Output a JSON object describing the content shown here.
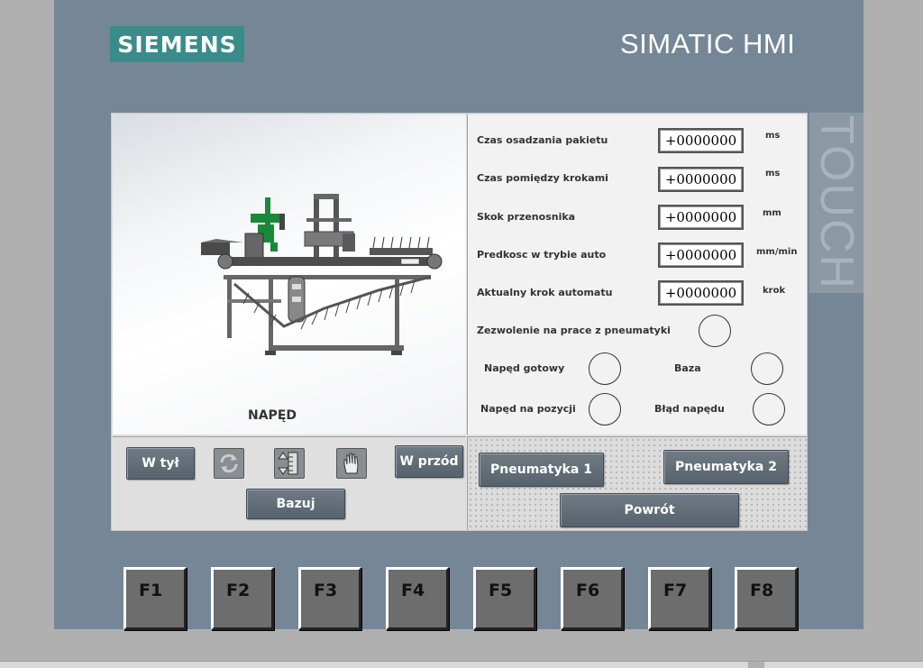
{
  "brand": {
    "logo": "SIEMENS",
    "product": "SIMATIC HMI",
    "panel_tag": "TOUCH"
  },
  "colors": {
    "logo_bg": "#3a8c8a",
    "bezel": "#758797",
    "button": "#646f7a",
    "machine_accent": "#1a8a3a"
  },
  "left_panel": {
    "drive_label": "NAPĘD",
    "buttons": {
      "back": "W tył",
      "forward": "W przód",
      "home": "Bazuj"
    },
    "icons": [
      "refresh-icon",
      "jog-icon",
      "hand-stop-icon"
    ]
  },
  "parameters": [
    {
      "label": "Czas osadzania pakietu",
      "value": "+0000000",
      "unit": "ms"
    },
    {
      "label": "Czas pomiędzy krokami",
      "value": "+0000000",
      "unit": "ms"
    },
    {
      "label": "Skok przenosnika",
      "value": "+0000000",
      "unit": "mm"
    },
    {
      "label": "Predkosc w trybie auto",
      "value": "+0000000",
      "unit": "mm/min"
    },
    {
      "label": "Aktualny krok automatu",
      "value": "+0000000",
      "unit": "krok"
    }
  ],
  "indicators": {
    "pneumatic_enable": "Zezwolenie na prace z pneumatyki",
    "drive_ready": "Napęd gotowy",
    "base": "Baza",
    "drive_in_position": "Napęd na pozycji",
    "drive_error": "Błąd napędu"
  },
  "right_buttons": {
    "pneumatics_1": "Pneumatyka 1",
    "pneumatics_2": "Pneumatyka 2",
    "back": "Powrót"
  },
  "function_keys": [
    "F1",
    "F2",
    "F3",
    "F4",
    "F5",
    "F6",
    "F7",
    "F8"
  ]
}
